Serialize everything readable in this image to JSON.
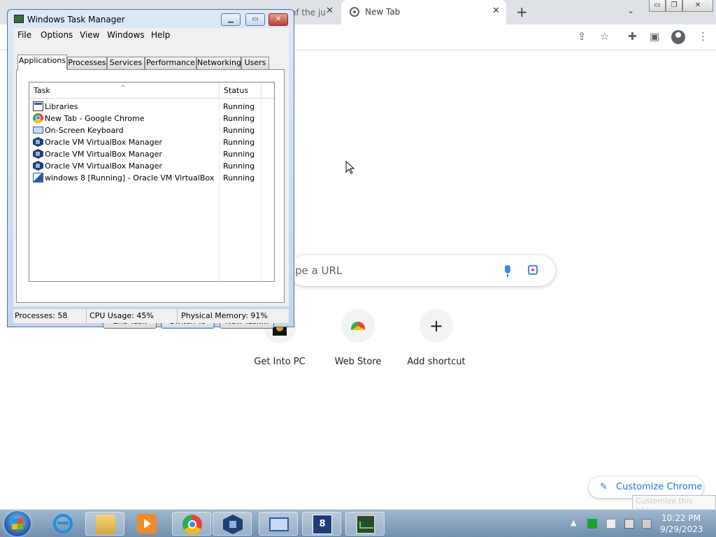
{
  "chrome": {
    "tabs": [
      {
        "label": "of the ju",
        "close": "✕"
      },
      {
        "label": "New Tab",
        "close": "✕"
      }
    ],
    "new_tab_symbol": "+",
    "search_placeholder": "pe a URL",
    "shortcuts": [
      {
        "label": "Get Into PC",
        "icon": "get-into-pc-icon"
      },
      {
        "label": "Web Store",
        "icon": "web-store-icon"
      },
      {
        "label": "Add shortcut",
        "icon": "plus-icon",
        "symbol": "+"
      }
    ],
    "customize_label": "Customize Chrome",
    "customize_tooltip": "Customize this page",
    "window_controls": [
      "▭",
      "❐",
      "✕"
    ],
    "toolbar_icons": [
      "share-icon",
      "star-icon",
      "extensions-icon",
      "side-panel-icon",
      "profile-icon",
      "menu-icon"
    ]
  },
  "taskmgr": {
    "title": "Windows Task Manager",
    "window_controls": {
      "minimize": "▁",
      "maximize": "▭",
      "close": "✕"
    },
    "menu": [
      "File",
      "Options",
      "View",
      "Windows",
      "Help"
    ],
    "tabs": [
      "Applications",
      "Processes",
      "Services",
      "Performance",
      "Networking",
      "Users"
    ],
    "active_tab": "Applications",
    "columns": {
      "task": "Task",
      "status": "Status"
    },
    "rows": [
      {
        "task": "Libraries",
        "status": "Running",
        "icon": "libraries-icon"
      },
      {
        "task": "New Tab - Google Chrome",
        "status": "Running",
        "icon": "chrome-icon"
      },
      {
        "task": "On-Screen Keyboard",
        "status": "Running",
        "icon": "keyboard-icon"
      },
      {
        "task": "Oracle VM VirtualBox Manager",
        "status": "Running",
        "icon": "virtualbox-icon"
      },
      {
        "task": "Oracle VM VirtualBox Manager",
        "status": "Running",
        "icon": "virtualbox-icon"
      },
      {
        "task": "Oracle VM VirtualBox Manager",
        "status": "Running",
        "icon": "virtualbox-icon"
      },
      {
        "task": "windows 8 [Running] - Oracle VM VirtualBox",
        "status": "Running",
        "icon": "vm-window-icon"
      }
    ],
    "buttons": {
      "end_task": "End Task",
      "switch_to": "Switch To",
      "new_task": "New Task..."
    },
    "statusbar": {
      "processes": "Processes: 58",
      "cpu": "CPU Usage: 45%",
      "memory": "Physical Memory: 91%"
    }
  },
  "taskbar": {
    "pinned": [
      "internet-explorer-icon",
      "file-explorer-icon",
      "media-player-icon",
      "chrome-icon",
      "virtualbox-icon",
      "on-screen-keyboard-icon",
      "windows8-vm-icon",
      "task-manager-icon"
    ],
    "windows8_badge": "8",
    "tray_arrow": "▲",
    "clock_time": "10:22 PM",
    "clock_date": "9/29/2023"
  }
}
